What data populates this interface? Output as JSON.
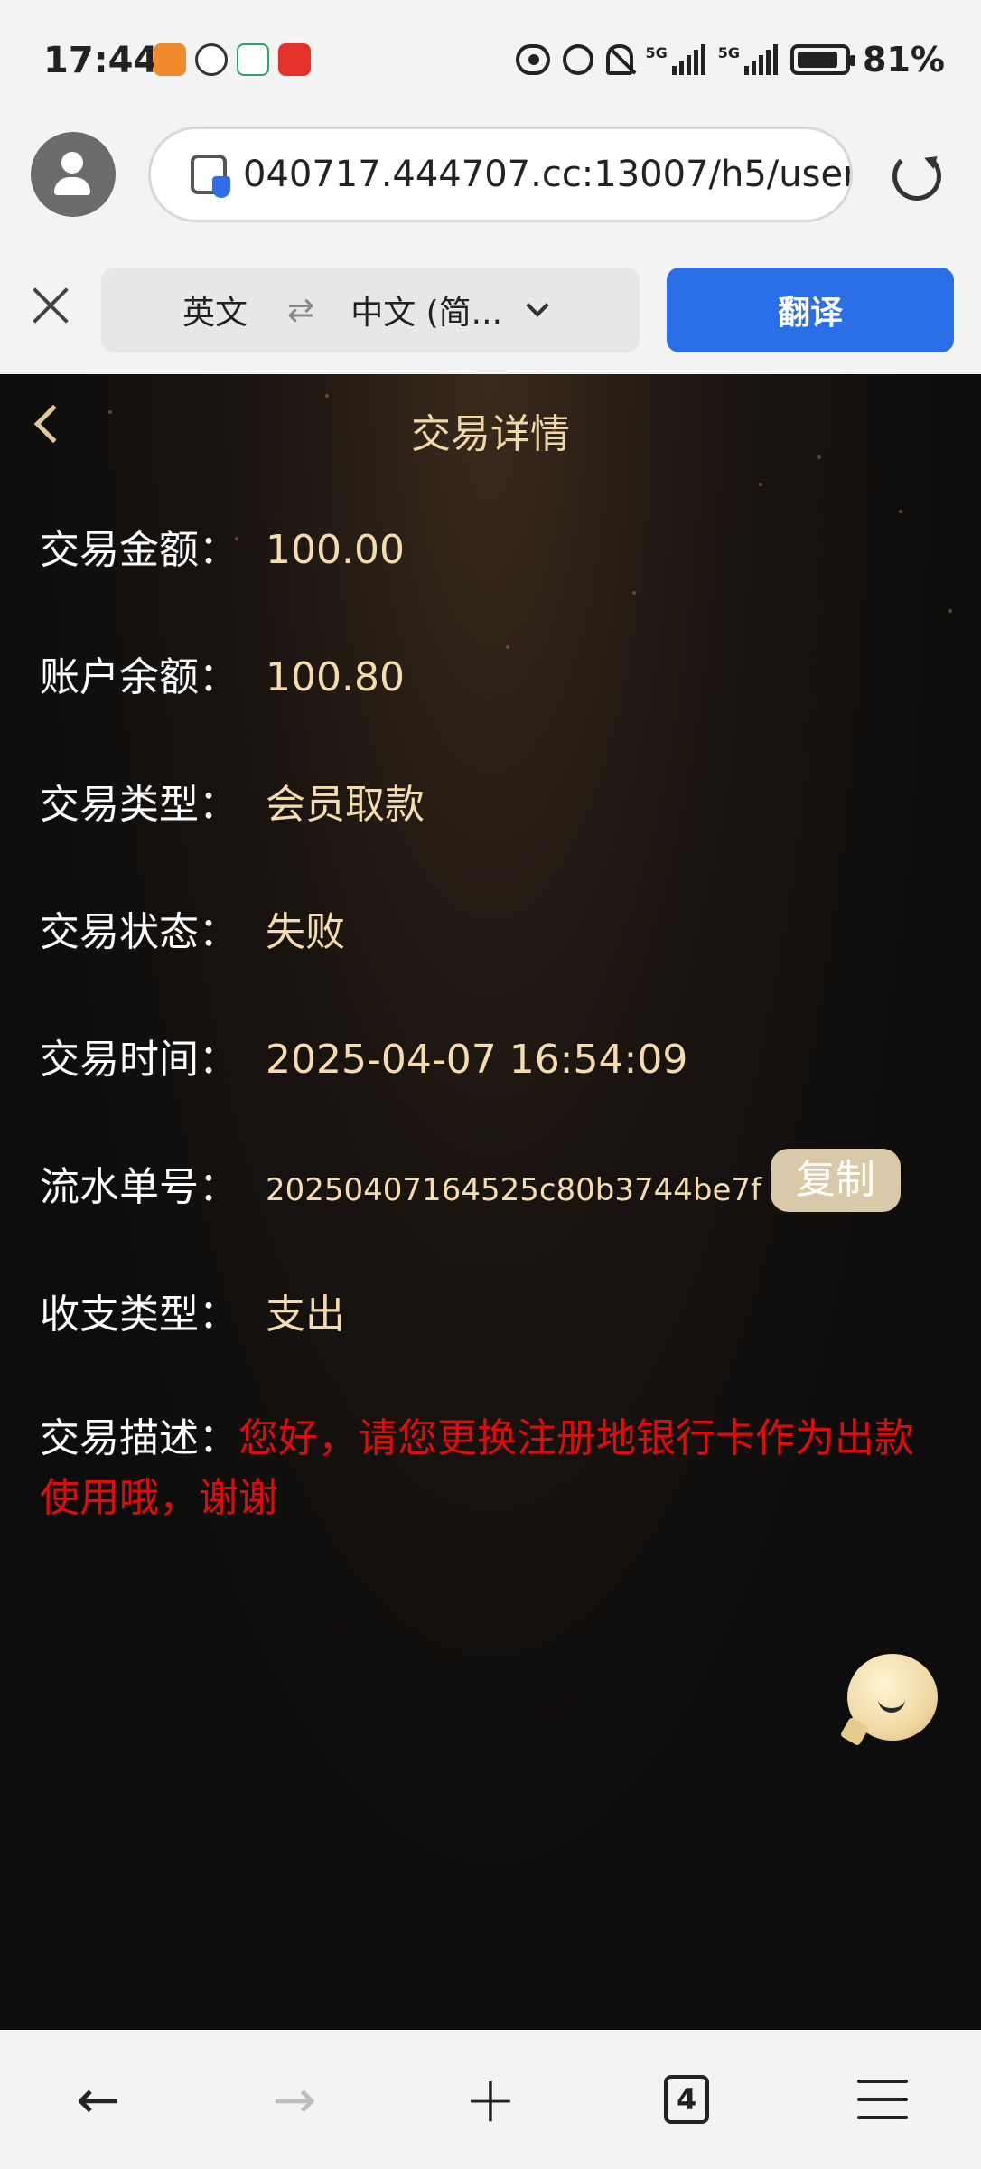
{
  "status_bar": {
    "time": "17:44",
    "network_1": "5G",
    "network_2": "5G",
    "battery": "81%"
  },
  "browser": {
    "url": "040717.444707.cc:13007/h5/user",
    "translate": {
      "source_lang": "英文",
      "swap_symbol": "⇄",
      "target_lang": "中文 (简...",
      "button_label": "翻译"
    }
  },
  "page": {
    "title": "交易详情",
    "details": [
      {
        "label": "交易金额：",
        "value": "100.00"
      },
      {
        "label": "账户余额：",
        "value": "100.80"
      },
      {
        "label": "交易类型：",
        "value": "会员取款"
      },
      {
        "label": "交易状态：",
        "value": "失败"
      },
      {
        "label": "交易时间：",
        "value": "2025-04-07 16:54:09"
      }
    ],
    "serial": {
      "label": "流水单号：",
      "value": "20250407164525c80b3744be7f",
      "copy_label": "复制"
    },
    "income_type": {
      "label": "收支类型：",
      "value": "支出"
    },
    "description": {
      "label": "交易描述：",
      "value": "您好，请您更换注册地银行卡作为出款使用哦，谢谢"
    }
  },
  "bottom_nav": {
    "back_symbol": "←",
    "forward_symbol": "→",
    "new_tab_symbol": "+",
    "tab_count": "4"
  },
  "colors": {
    "accent_blue": "#2a6fe8",
    "gold_text": "#f4dcae",
    "error_red": "#e00b0b"
  }
}
